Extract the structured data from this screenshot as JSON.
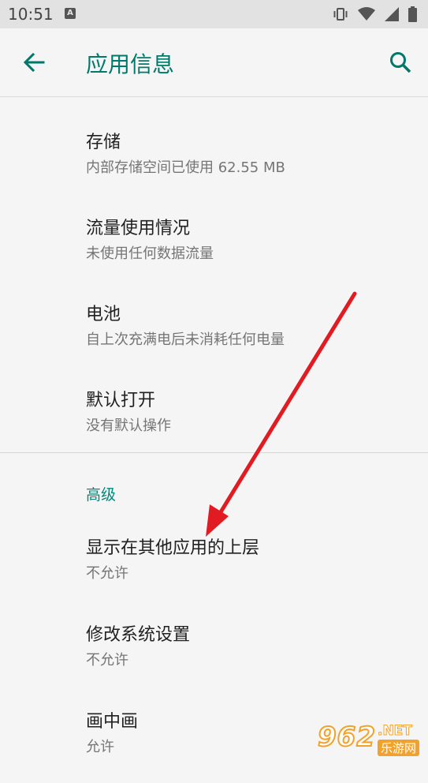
{
  "status_bar": {
    "time": "10:51",
    "notification_glyph": "A",
    "icons": [
      "vibrate-icon",
      "wifi-icon",
      "signal-icon",
      "battery-icon"
    ]
  },
  "app_bar": {
    "title": "应用信息",
    "back_icon": "arrow-back-icon",
    "search_icon": "search-icon"
  },
  "items": [
    {
      "title": "存储",
      "summary": "内部存储空间已使用 62.55 MB"
    },
    {
      "title": "流量使用情况",
      "summary": "未使用任何数据流量"
    },
    {
      "title": "电池",
      "summary": "自上次充满电后未消耗任何电量"
    },
    {
      "title": "默认打开",
      "summary": "没有默认操作"
    }
  ],
  "advanced": {
    "header": "高级",
    "items": [
      {
        "title": "显示在其他应用的上层",
        "summary": "不允许"
      },
      {
        "title": "修改系统设置",
        "summary": "不允许"
      },
      {
        "title": "画中画",
        "summary": "允许"
      }
    ]
  },
  "watermark": {
    "number": "962",
    "suffix": ".NET",
    "text": "乐游网"
  },
  "colors": {
    "accent": "#00796b",
    "arrow": "#e21b23",
    "status_bar": "#e2e2e2",
    "background": "#f5f5f5"
  }
}
